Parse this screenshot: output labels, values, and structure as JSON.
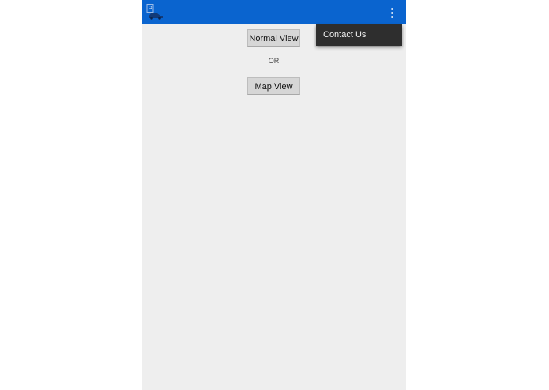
{
  "app": {
    "icon": "parking-car-icon",
    "menu_icon": "overflow-menu-icon",
    "colors": {
      "actionbar": "#0a64cf",
      "background": "#eeeeee",
      "menu": "#2e2e2e"
    }
  },
  "main": {
    "normal_view_label": "Normal View",
    "separator_text": "OR",
    "map_view_label": "Map View"
  },
  "overflow_menu": {
    "items": [
      {
        "label": "Contact Us"
      }
    ]
  }
}
